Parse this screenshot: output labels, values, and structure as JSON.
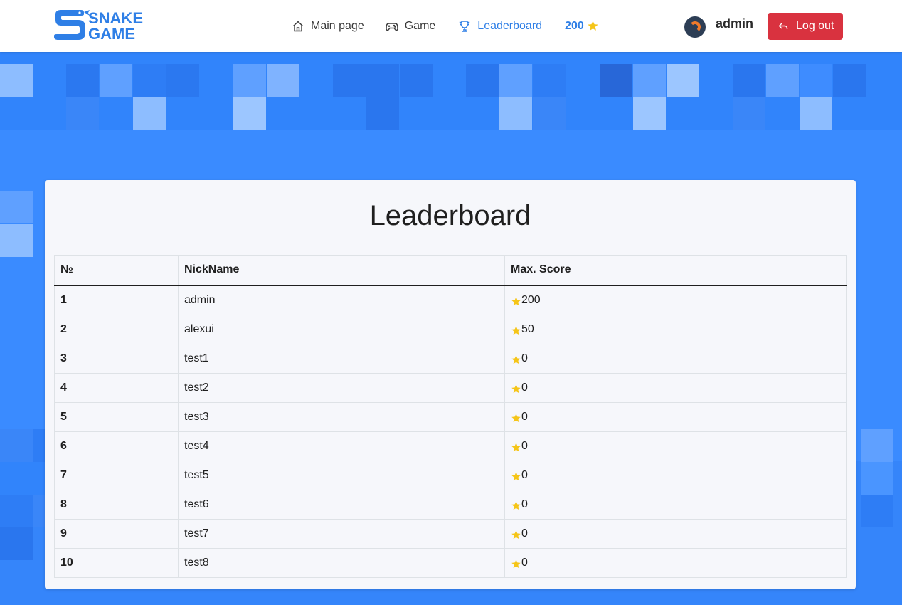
{
  "header": {
    "logo_text": [
      "SNAKE",
      "GAME"
    ],
    "nav": [
      {
        "label": "Main page",
        "icon": "home-icon",
        "active": false
      },
      {
        "label": "Game",
        "icon": "gamepad-icon",
        "active": false
      },
      {
        "label": "Leaderboard",
        "icon": "trophy-icon",
        "active": true
      }
    ],
    "score": "200",
    "score_icon": "star-icon",
    "username": "admin",
    "logout_label": "Log out"
  },
  "leaderboard": {
    "title": "Leaderboard",
    "columns": [
      "№",
      "NickName",
      "Max. Score"
    ],
    "rows": [
      {
        "rank": "1",
        "nick": "admin",
        "score": "200"
      },
      {
        "rank": "2",
        "nick": "alexui",
        "score": "50"
      },
      {
        "rank": "3",
        "nick": "test1",
        "score": "0"
      },
      {
        "rank": "4",
        "nick": "test2",
        "score": "0"
      },
      {
        "rank": "5",
        "nick": "test3",
        "score": "0"
      },
      {
        "rank": "6",
        "nick": "test4",
        "score": "0"
      },
      {
        "rank": "7",
        "nick": "test5",
        "score": "0"
      },
      {
        "rank": "8",
        "nick": "test6",
        "score": "0"
      },
      {
        "rank": "9",
        "nick": "test7",
        "score": "0"
      },
      {
        "rank": "10",
        "nick": "test8",
        "score": "0"
      }
    ]
  },
  "colors": {
    "accent": "#2f7fe6",
    "logout": "#d9323f",
    "background": "#3a8bff",
    "star": "#f5c518"
  }
}
